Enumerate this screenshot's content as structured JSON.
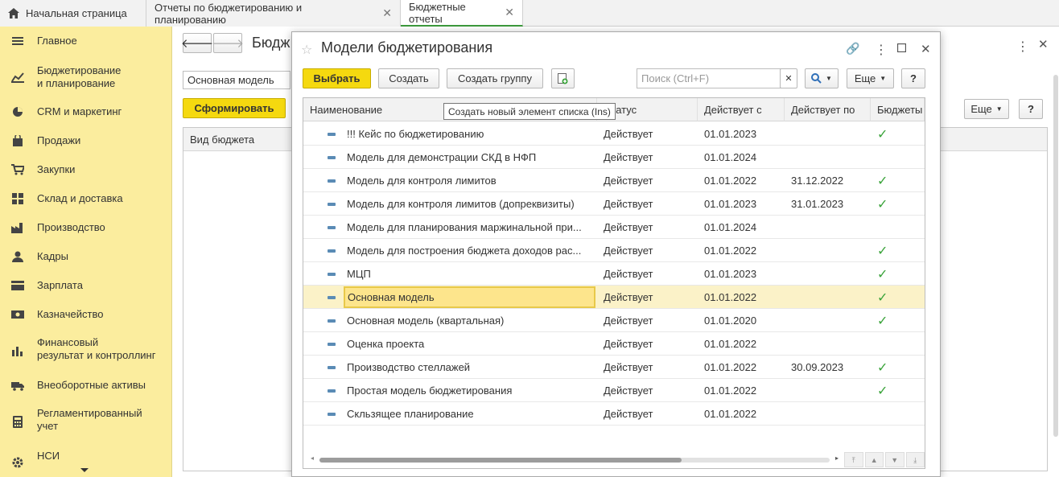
{
  "tabs": [
    {
      "label": "Начальная страница"
    },
    {
      "label": "Отчеты по бюджетированию и планированию"
    },
    {
      "label": "Бюджетные отчеты"
    }
  ],
  "sidebar": {
    "items": [
      {
        "label": "Главное",
        "icon": "menu-icon"
      },
      {
        "label": "Бюджетирование\nи планирование",
        "icon": "budget-chart-icon"
      },
      {
        "label": "CRM и маркетинг",
        "icon": "pie-chart-icon"
      },
      {
        "label": "Продажи",
        "icon": "shopping-bag-icon"
      },
      {
        "label": "Закупки",
        "icon": "cart-icon"
      },
      {
        "label": "Склад и доставка",
        "icon": "warehouse-grid-icon"
      },
      {
        "label": "Производство",
        "icon": "factory-icon"
      },
      {
        "label": "Кадры",
        "icon": "person-icon"
      },
      {
        "label": "Зарплата",
        "icon": "wallet-icon"
      },
      {
        "label": "Казначейство",
        "icon": "money-icon"
      },
      {
        "label": "Финансовый\nрезультат и контроллинг",
        "icon": "bar-chart-icon"
      },
      {
        "label": "Внеоборотные активы",
        "icon": "truck-icon"
      },
      {
        "label": "Регламентированный\nучет",
        "icon": "calculator-icon"
      },
      {
        "label": "НСИ",
        "icon": "gear-icon"
      }
    ]
  },
  "background_form": {
    "title": "Бюдж",
    "model_field": "Основная модель",
    "generate_button": "Сформировать",
    "more_button": "Еще",
    "help_button": "?",
    "column_budget_type": "Вид бюджета"
  },
  "modal": {
    "title": "Модели бюджетирования",
    "select_button": "Выбрать",
    "create_button": "Создать",
    "create_group_button": "Создать группу",
    "search_placeholder": "Поиск (Ctrl+F)",
    "more_button": "Еще",
    "help_button": "?",
    "tooltip": "Создать новый элемент списка (Ins)",
    "columns": [
      "Наименование",
      "Статус",
      "Действует с",
      "Действует по",
      "Бюджеты"
    ],
    "rows": [
      {
        "name": "!!! Кейс по бюджетированию",
        "status": "Действует",
        "from": "01.01.2023",
        "to": "",
        "budgets": true
      },
      {
        "name": "Модель для демонстрации СКД в НФП",
        "status": "Действует",
        "from": "01.01.2024",
        "to": "",
        "budgets": false
      },
      {
        "name": "Модель для контроля лимитов",
        "status": "Действует",
        "from": "01.01.2022",
        "to": "31.12.2022",
        "budgets": true
      },
      {
        "name": "Модель для контроля лимитов (допреквизиты)",
        "status": "Действует",
        "from": "01.01.2023",
        "to": "31.01.2023",
        "budgets": true
      },
      {
        "name": "Модель для планирования маржинальной при...",
        "status": "Действует",
        "from": "01.01.2024",
        "to": "",
        "budgets": false
      },
      {
        "name": "Модель для построения бюджета доходов рас...",
        "status": "Действует",
        "from": "01.01.2022",
        "to": "",
        "budgets": true
      },
      {
        "name": "МЦП",
        "status": "Действует",
        "from": "01.01.2023",
        "to": "",
        "budgets": true
      },
      {
        "name": "Основная модель",
        "status": "Действует",
        "from": "01.01.2022",
        "to": "",
        "budgets": true,
        "selected": true
      },
      {
        "name": "Основная модель (квартальная)",
        "status": "Действует",
        "from": "01.01.2020",
        "to": "",
        "budgets": true
      },
      {
        "name": "Оценка проекта",
        "status": "Действует",
        "from": "01.01.2022",
        "to": "",
        "budgets": false
      },
      {
        "name": "Производство стеллажей",
        "status": "Действует",
        "from": "01.01.2022",
        "to": "30.09.2023",
        "budgets": true
      },
      {
        "name": "Простая модель бюджетирования",
        "status": "Действует",
        "from": "01.01.2022",
        "to": "",
        "budgets": true
      },
      {
        "name": "Скльзящее планирование",
        "status": "Действует",
        "from": "01.01.2022",
        "to": "",
        "budgets": false
      }
    ]
  },
  "colors": {
    "sidebar_bg": "#fbed9e",
    "accent_yellow": "#f5d90f",
    "check_green": "#3aa33a",
    "selected_row": "#fbf2c8"
  }
}
